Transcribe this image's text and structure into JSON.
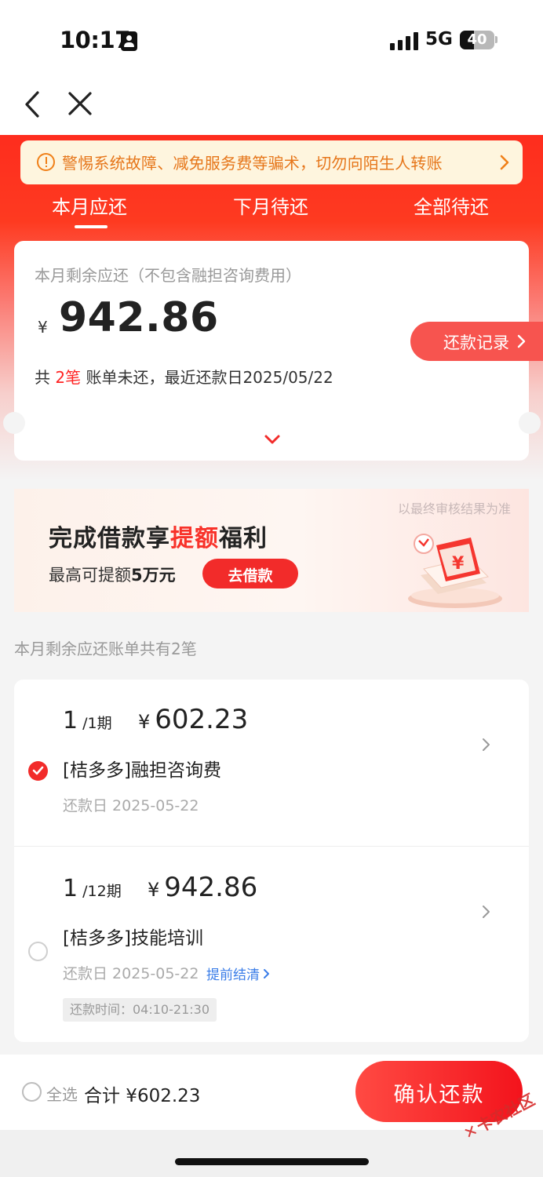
{
  "status_bar": {
    "time": "10:17",
    "network": "5G",
    "battery": "40"
  },
  "notice": {
    "text": "警惕系统故障、减免服务费等骗术，切勿向陌生人转账"
  },
  "tabs": [
    {
      "label": "本月应还",
      "active": true
    },
    {
      "label": "下月待还",
      "active": false
    },
    {
      "label": "全部待还",
      "active": false
    }
  ],
  "summary": {
    "title": "本月剩余应还（不包含融担咨询费用）",
    "currency": "¥",
    "amount": "942.86",
    "sub_prefix": "共 ",
    "count": "2笔",
    "sub_suffix": " 账单未还，最近还款日2025/05/22",
    "record_button": "还款记录"
  },
  "banner": {
    "note": "以最终审核结果为准",
    "title_part1": "完成借款享",
    "title_highlight": "提额",
    "title_part2": "福利",
    "sub_prefix": "最高可提额",
    "sub_amount": "5万元",
    "button": "去借款"
  },
  "list_header": "本月剩余应还账单共有2笔",
  "bills": [
    {
      "period_num": "1",
      "period_total": " /1期",
      "currency": "¥",
      "amount": "602.23",
      "name": "[桔多多]融担咨询费",
      "date": "还款日 2025-05-22",
      "checked": true
    },
    {
      "period_num": "1",
      "period_total": " /12期",
      "currency": "¥",
      "amount": "942.86",
      "name": "[桔多多]技能培训",
      "date": "还款日 2025-05-22",
      "link": "提前结清",
      "time": "还款时间：04:10-21:30",
      "checked": false
    }
  ],
  "footer": {
    "select_all": "全选",
    "total": "合计 ¥602.23",
    "confirm_button": "确认还款"
  },
  "watermark": "卡农社区",
  "colors": {
    "primary_red": "#f22b2a",
    "notice_bg": "#fef5de",
    "notice_text": "#e6761a",
    "link_blue": "#3a7de8"
  },
  "icons": [
    "person-icon",
    "back-icon",
    "close-icon",
    "warning-icon",
    "chevron-right-icon",
    "chevron-down-icon",
    "check-icon"
  ]
}
